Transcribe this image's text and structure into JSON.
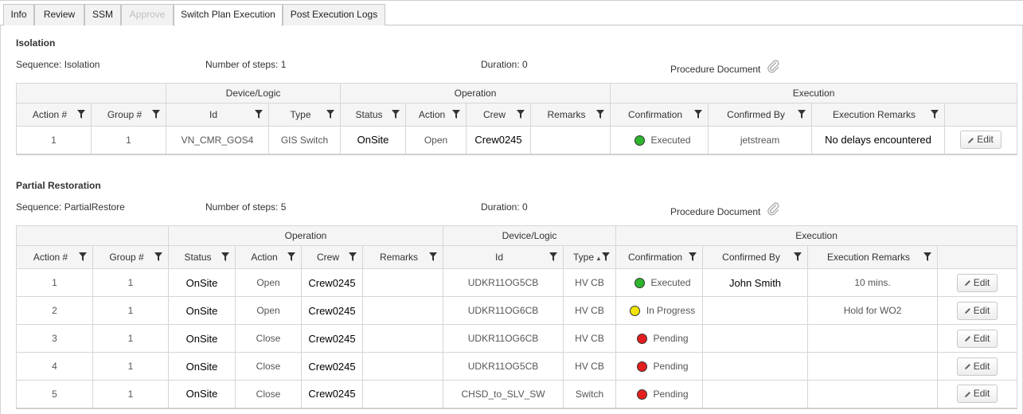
{
  "tabs": [
    {
      "label": "Info"
    },
    {
      "label": "Review"
    },
    {
      "label": "SSM"
    },
    {
      "label": "Approve"
    },
    {
      "label": "Switch Plan Execution"
    },
    {
      "label": "Post Execution Logs"
    }
  ],
  "colors": {
    "executed": "#2db52d",
    "in_progress": "#f2e600",
    "pending": "#e41e1e"
  },
  "isolation": {
    "title": "Isolation",
    "sequence": "Sequence: Isolation",
    "steps": "Number of steps: 1",
    "duration": "Duration: 0",
    "procedure_doc": "Procedure Document",
    "groups": {
      "device": "Device/Logic",
      "operation": "Operation",
      "execution": "Execution"
    },
    "headers": [
      "Action #",
      "Group #",
      "Id",
      "Type",
      "Status",
      "Action",
      "Crew",
      "Remarks",
      "Confirmation",
      "Confirmed By",
      "Execution Remarks"
    ],
    "rows": [
      {
        "action_no": "1",
        "group_no": "1",
        "id": "VN_CMR_GOS4",
        "type": "GIS Switch",
        "status": "OnSite",
        "action": "Open",
        "crew": "Crew0245",
        "remarks": "",
        "confirmation": "Executed",
        "confirm_color": "executed",
        "confirmed_by": "jetstream",
        "exec_remarks": "No delays encountered",
        "edit": "Edit"
      }
    ]
  },
  "partial": {
    "title": "Partial Restoration",
    "sequence": "Sequence: PartialRestore",
    "steps": "Number of steps: 5",
    "duration": "Duration: 0",
    "procedure_doc": "Procedure Document",
    "groups": {
      "operation": "Operation",
      "device": "Device/Logic",
      "execution": "Execution"
    },
    "headers": [
      "Action #",
      "Group #",
      "Status",
      "Action",
      "Crew",
      "Remarks",
      "Id",
      "Type",
      "Confirmation",
      "Confirmed By",
      "Execution Remarks"
    ],
    "rows": [
      {
        "action_no": "1",
        "group_no": "1",
        "status": "OnSite",
        "action": "Open",
        "crew": "Crew0245",
        "remarks": "",
        "id": "UDKR11OG5CB",
        "type": "HV CB",
        "confirmation": "Executed",
        "confirm_color": "executed",
        "confirmed_by": "John Smith",
        "exec_remarks": "10 mins.",
        "edit": "Edit"
      },
      {
        "action_no": "2",
        "group_no": "1",
        "status": "OnSite",
        "action": "Open",
        "crew": "Crew0245",
        "remarks": "",
        "id": "UDKR11OG6CB",
        "type": "HV CB",
        "confirmation": "In Progress",
        "confirm_color": "in_progress",
        "confirmed_by": "",
        "exec_remarks": "Hold for WO2",
        "edit": "Edit"
      },
      {
        "action_no": "3",
        "group_no": "1",
        "status": "OnSite",
        "action": "Close",
        "crew": "Crew0245",
        "remarks": "",
        "id": "UDKR11OG6CB",
        "type": "HV CB",
        "confirmation": "Pending",
        "confirm_color": "pending",
        "confirmed_by": "",
        "exec_remarks": "",
        "edit": "Edit"
      },
      {
        "action_no": "4",
        "group_no": "1",
        "status": "OnSite",
        "action": "Close",
        "crew": "Crew0245",
        "remarks": "",
        "id": "UDKR11OG5CB",
        "type": "HV CB",
        "confirmation": "Pending",
        "confirm_color": "pending",
        "confirmed_by": "",
        "exec_remarks": "",
        "edit": "Edit"
      },
      {
        "action_no": "5",
        "group_no": "1",
        "status": "OnSite",
        "action": "Close",
        "crew": "Crew0245",
        "remarks": "",
        "id": "CHSD_to_SLV_SW",
        "type": "Switch",
        "confirmation": "Pending",
        "confirm_color": "pending",
        "confirmed_by": "",
        "exec_remarks": "",
        "edit": "Edit"
      }
    ]
  }
}
